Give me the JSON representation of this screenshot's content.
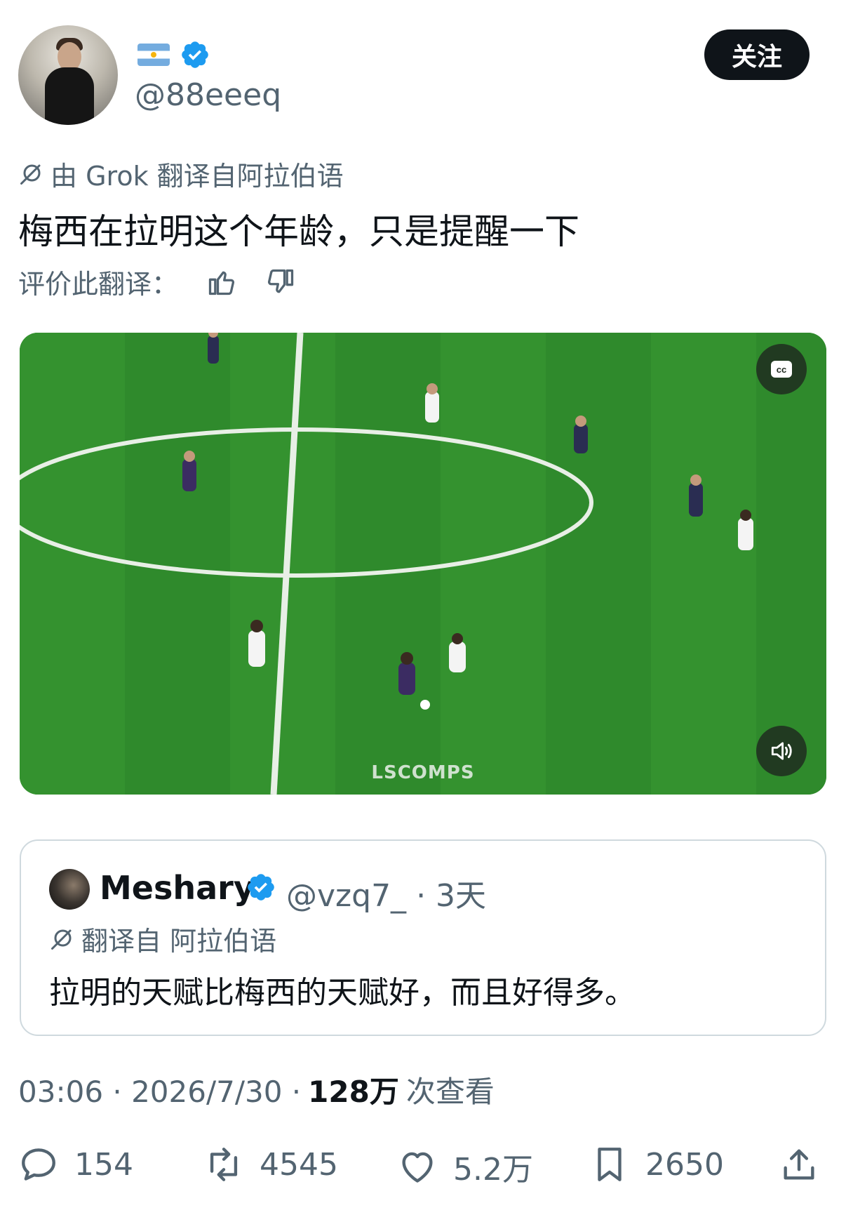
{
  "author": {
    "flag_icon": "argentina-flag-icon",
    "handle": "@88eeeq",
    "follow_label": "关注"
  },
  "translation": {
    "translated_by": "由 Grok 翻译自阿拉伯语",
    "text": "梅西在拉明这个年龄，只是提醒一下",
    "rate_label": "评价此翻译："
  },
  "video": {
    "watermark": "LSCOMPS",
    "cc_icon": "closed-captions-icon",
    "volume_icon": "speaker-muted-icon"
  },
  "quoted": {
    "name": "Meshary",
    "handle": "@vzq7_",
    "time": "· 3天",
    "translated_from": "翻译自 阿拉伯语",
    "text": "拉明的天赋比梅西的天赋好，而且好得多。"
  },
  "meta": {
    "time": "03:06 · 2026/7/30 ·",
    "views": "128万",
    "views_label": "次查看"
  },
  "stats": {
    "replies": "154",
    "retweets": "4545",
    "likes": "5.2万",
    "bookmarks": "2650"
  },
  "colors": {
    "verified": "#1d9bf0",
    "text_primary": "#0f1419",
    "text_secondary": "#536471",
    "pitch": "#2f8a2c"
  }
}
